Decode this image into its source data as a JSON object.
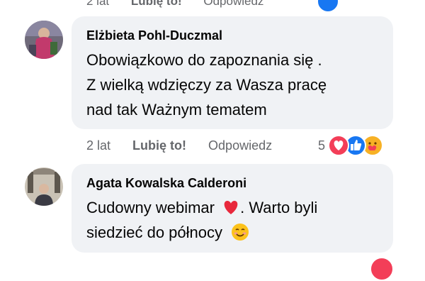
{
  "top_row": {
    "time": "2 lat",
    "like": "Lubię to!",
    "reply": "Odpowiedz"
  },
  "comments": [
    {
      "author": "Elżbieta Pohl-Duczmal",
      "lines": [
        "Obowiązkowo do zapoznania się .",
        "Z wielką wdzięczy za Wasza pracę",
        "nad tak Ważnym tematem"
      ],
      "time": "2 lat",
      "like": "Lubię to!",
      "reply": "Odpowiedz",
      "reaction_count": "5",
      "reactions": [
        "heart-icon",
        "like-icon",
        "care-icon"
      ]
    },
    {
      "author": "Agata Kowalska Calderoni",
      "line1_before": "Cudowny webimar",
      "line1_after": ". Warto byli",
      "line2": "siedzieć do północy",
      "emoji": [
        "heart-emoji",
        "smiling-face-emoji"
      ]
    }
  ],
  "colors": {
    "bubble": "#f0f2f5",
    "secondary_text": "#65676b",
    "like_blue": "#1877f2",
    "heart_red": "#f33e58"
  }
}
